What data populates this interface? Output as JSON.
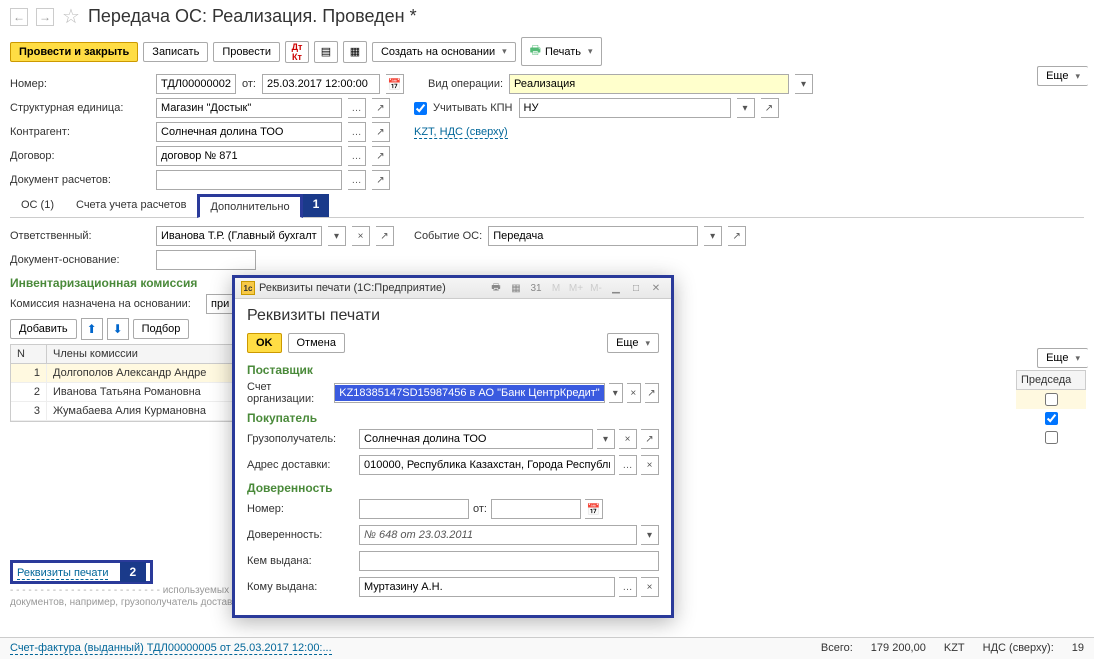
{
  "header": {
    "title": "Передача ОС: Реализация. Проведен *"
  },
  "toolbar": {
    "post_close": "Провести и закрыть",
    "record": "Записать",
    "post": "Провести",
    "create_based": "Создать на основании",
    "print": "Печать",
    "more": "Еще"
  },
  "form": {
    "number_label": "Номер:",
    "number_value": "ТДЛ00000002",
    "from_label": "от:",
    "date_value": "25.03.2017 12:00:00",
    "op_type_label": "Вид операции:",
    "op_type_value": "Реализация",
    "unit_label": "Структурная единица:",
    "unit_value": "Магазин \"Достык\"",
    "kpn_label": "Учитывать КПН",
    "kpn_value": "НУ",
    "contractor_label": "Контрагент:",
    "contractor_value": "Солнечная долина ТОО",
    "tax_link": "KZT, НДС (сверху)",
    "contract_label": "Договор:",
    "contract_value": "договор № 871",
    "settlement_doc_label": "Документ расчетов:",
    "settlement_doc_value": ""
  },
  "tabs": {
    "t1": "ОС (1)",
    "t2": "Счета учета расчетов",
    "t3": "Дополнительно"
  },
  "markers": {
    "m1": "1",
    "m2": "2"
  },
  "add_tab": {
    "resp_label": "Ответственный:",
    "resp_value": "Иванова Т.Р. (Главный бухгалте",
    "event_label": "Событие ОС:",
    "event_value": "Передача",
    "basis_doc_label": "Документ-основание:",
    "basis_doc_value": "",
    "commission_title": "Инвентаризационная комиссия",
    "commission_basis_label": "Комиссия назначена на основании:",
    "commission_basis_value": "при",
    "add_btn": "Добавить",
    "select_btn": "Подбор",
    "col_n": "N",
    "col_members": "Члены комиссии",
    "col_chair": "Председа",
    "rows": [
      {
        "n": "1",
        "name": "Долгополов Александр Андре"
      },
      {
        "n": "2",
        "name": "Иванова Татьяна Романовна"
      },
      {
        "n": "3",
        "name": "Жумабаева Алия Курмановна"
      }
    ]
  },
  "print_link": "Реквизиты печати",
  "foot_note": "документов, например, грузополучатель\nдоставки и т.д.",
  "dialog": {
    "win_title": "Реквизиты печати (1С:Предприятие)",
    "heading": "Реквизиты печати",
    "ok": "OK",
    "cancel": "Отмена",
    "more": "Еще",
    "supplier": "Поставщик",
    "acc_label": "Счет организации:",
    "acc_value": "KZ18385147SD15987456 в АО \"Банк ЦентрКредит\"",
    "buyer": "Покупатель",
    "consignee_label": "Грузополучатель:",
    "consignee_value": "Солнечная долина ТОО",
    "addr_label": "Адрес доставки:",
    "addr_value": "010000, Республика Казахстан, Города Республиканск",
    "proxy": "Доверенность",
    "num_label": "Номер:",
    "num_value": "",
    "from_label": "от:",
    "from_value": "",
    "proxy_label": "Доверенность:",
    "proxy_value": "№ 648 от 23.03.2011",
    "issued_by_label": "Кем выдана:",
    "issued_by_value": "",
    "issued_to_label": "Кому выдана:",
    "issued_to_value": "Муртазину А.Н."
  },
  "status": {
    "invoice": "Счет-фактура (выданный) ТДЛ00000005 от 25.03.2017 12:00:...",
    "total_label": "Всего:",
    "total_value": "179 200,00",
    "currency": "KZT",
    "vat_label": "НДС (сверху):",
    "vat_value": "19"
  }
}
